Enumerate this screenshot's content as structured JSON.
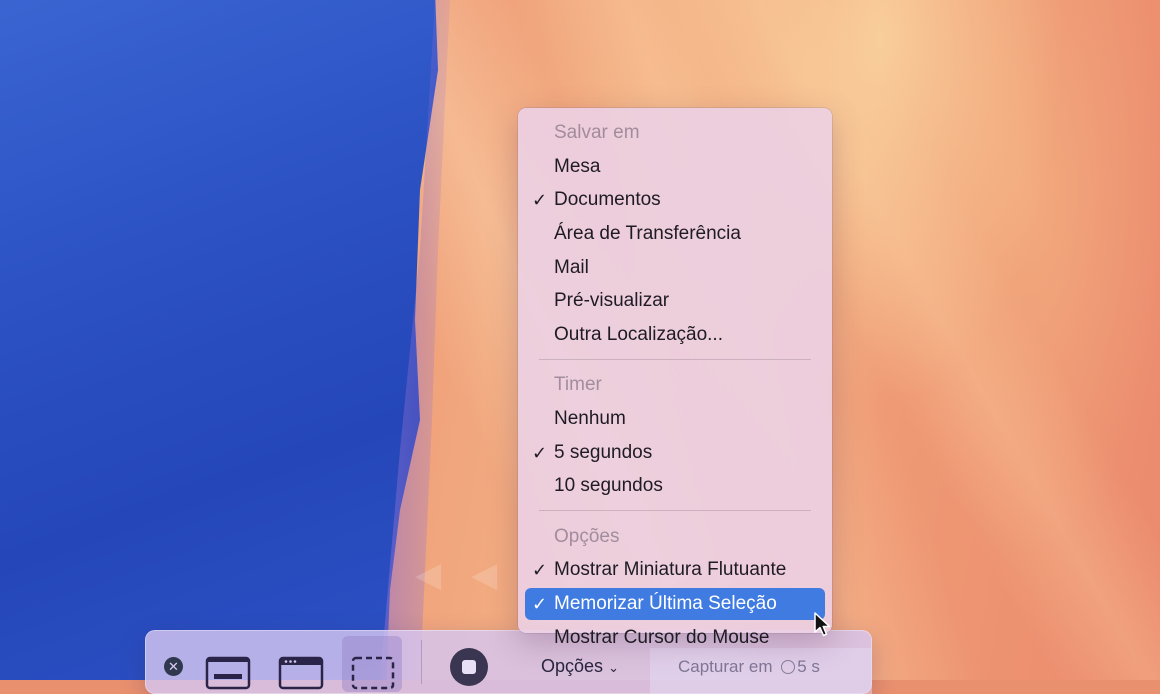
{
  "menu": {
    "save_header": "Salvar em",
    "save_items": [
      {
        "label": "Mesa",
        "checked": false
      },
      {
        "label": "Documentos",
        "checked": true
      },
      {
        "label": "Área de Transferência",
        "checked": false
      },
      {
        "label": "Mail",
        "checked": false
      },
      {
        "label": "Pré-visualizar",
        "checked": false
      },
      {
        "label": "Outra Localização...",
        "checked": false
      }
    ],
    "timer_header": "Timer",
    "timer_items": [
      {
        "label": "Nenhum",
        "checked": false
      },
      {
        "label": "5 segundos",
        "checked": true
      },
      {
        "label": "10 segundos",
        "checked": false
      }
    ],
    "options_header": "Opções",
    "options_items": [
      {
        "label": "Mostrar Miniatura Flutuante",
        "checked": true
      },
      {
        "label": "Memorizar Última Seleção",
        "checked": true,
        "highlighted": true
      },
      {
        "label": "Mostrar Cursor do Mouse",
        "checked": false
      }
    ],
    "check_glyph": "✓",
    "highlight_color": "#3f7be0"
  },
  "toolbar": {
    "options_label": "Opções",
    "capture_label": "Capturar em",
    "capture_seconds": "5 s",
    "close_glyph": "✕",
    "chevron_glyph": "⌄",
    "icons": [
      "close-icon",
      "capture-screen-icon",
      "capture-window-icon",
      "capture-selection-icon",
      "record-icon",
      "chevron-down-icon",
      "clock-icon"
    ]
  },
  "background": {
    "media_glyphs": "◀◀ ▶ ▶▶"
  }
}
